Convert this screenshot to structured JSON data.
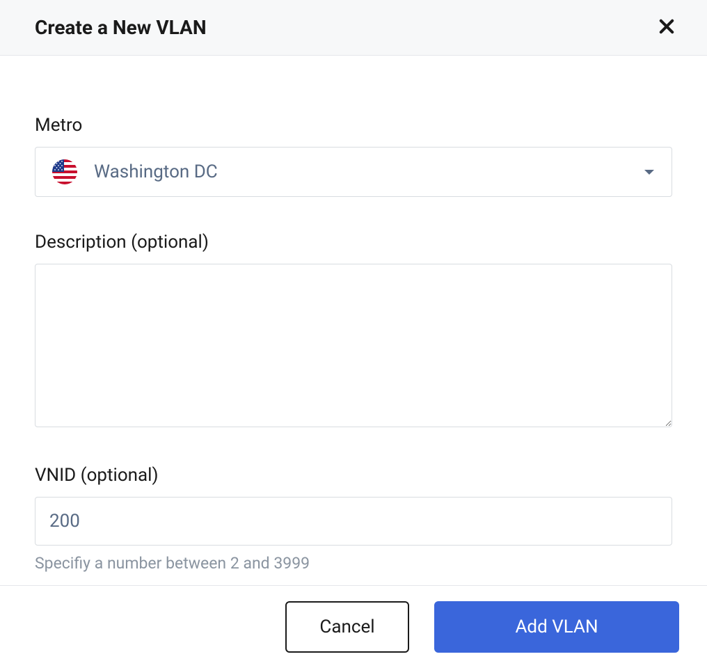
{
  "header": {
    "title": "Create a New VLAN"
  },
  "form": {
    "metro": {
      "label": "Metro",
      "value": "Washington DC"
    },
    "description": {
      "label": "Description (optional)",
      "value": ""
    },
    "vnid": {
      "label": "VNID (optional)",
      "value": "200",
      "helper": "Specifiy a number between 2 and 3999"
    }
  },
  "footer": {
    "cancel": "Cancel",
    "submit": "Add VLAN"
  }
}
